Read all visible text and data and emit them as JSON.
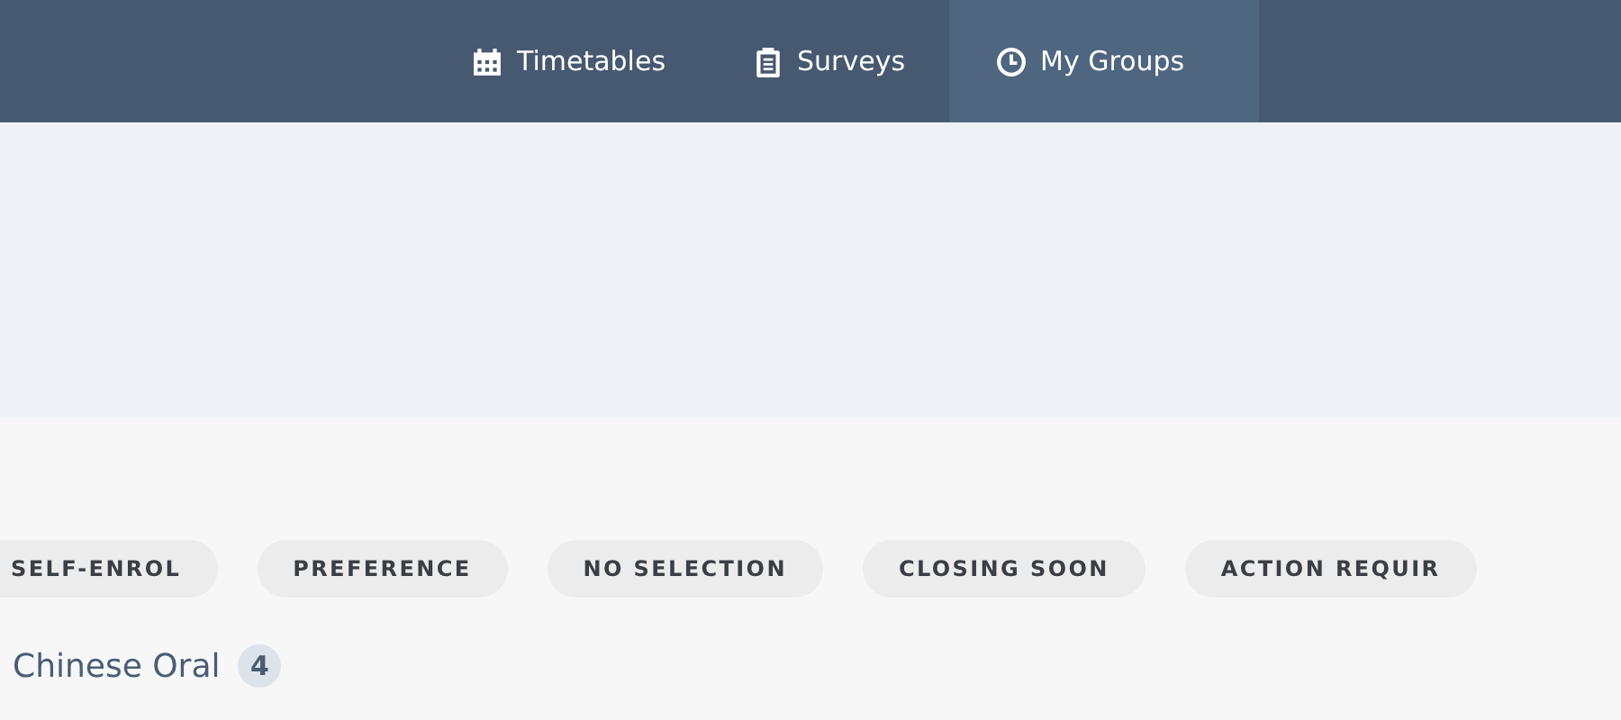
{
  "nav": {
    "tabs": [
      {
        "label": "Timetables",
        "selected": false
      },
      {
        "label": "Surveys",
        "selected": false
      },
      {
        "label": "My Groups",
        "selected": true
      }
    ]
  },
  "filters": [
    {
      "label": "SELF-ENROL"
    },
    {
      "label": "PREFERENCE"
    },
    {
      "label": "NO SELECTION"
    },
    {
      "label": "CLOSING SOON"
    },
    {
      "label": "ACTION REQUIR"
    }
  ],
  "group": {
    "title": "Chinese Oral",
    "count": "4"
  }
}
